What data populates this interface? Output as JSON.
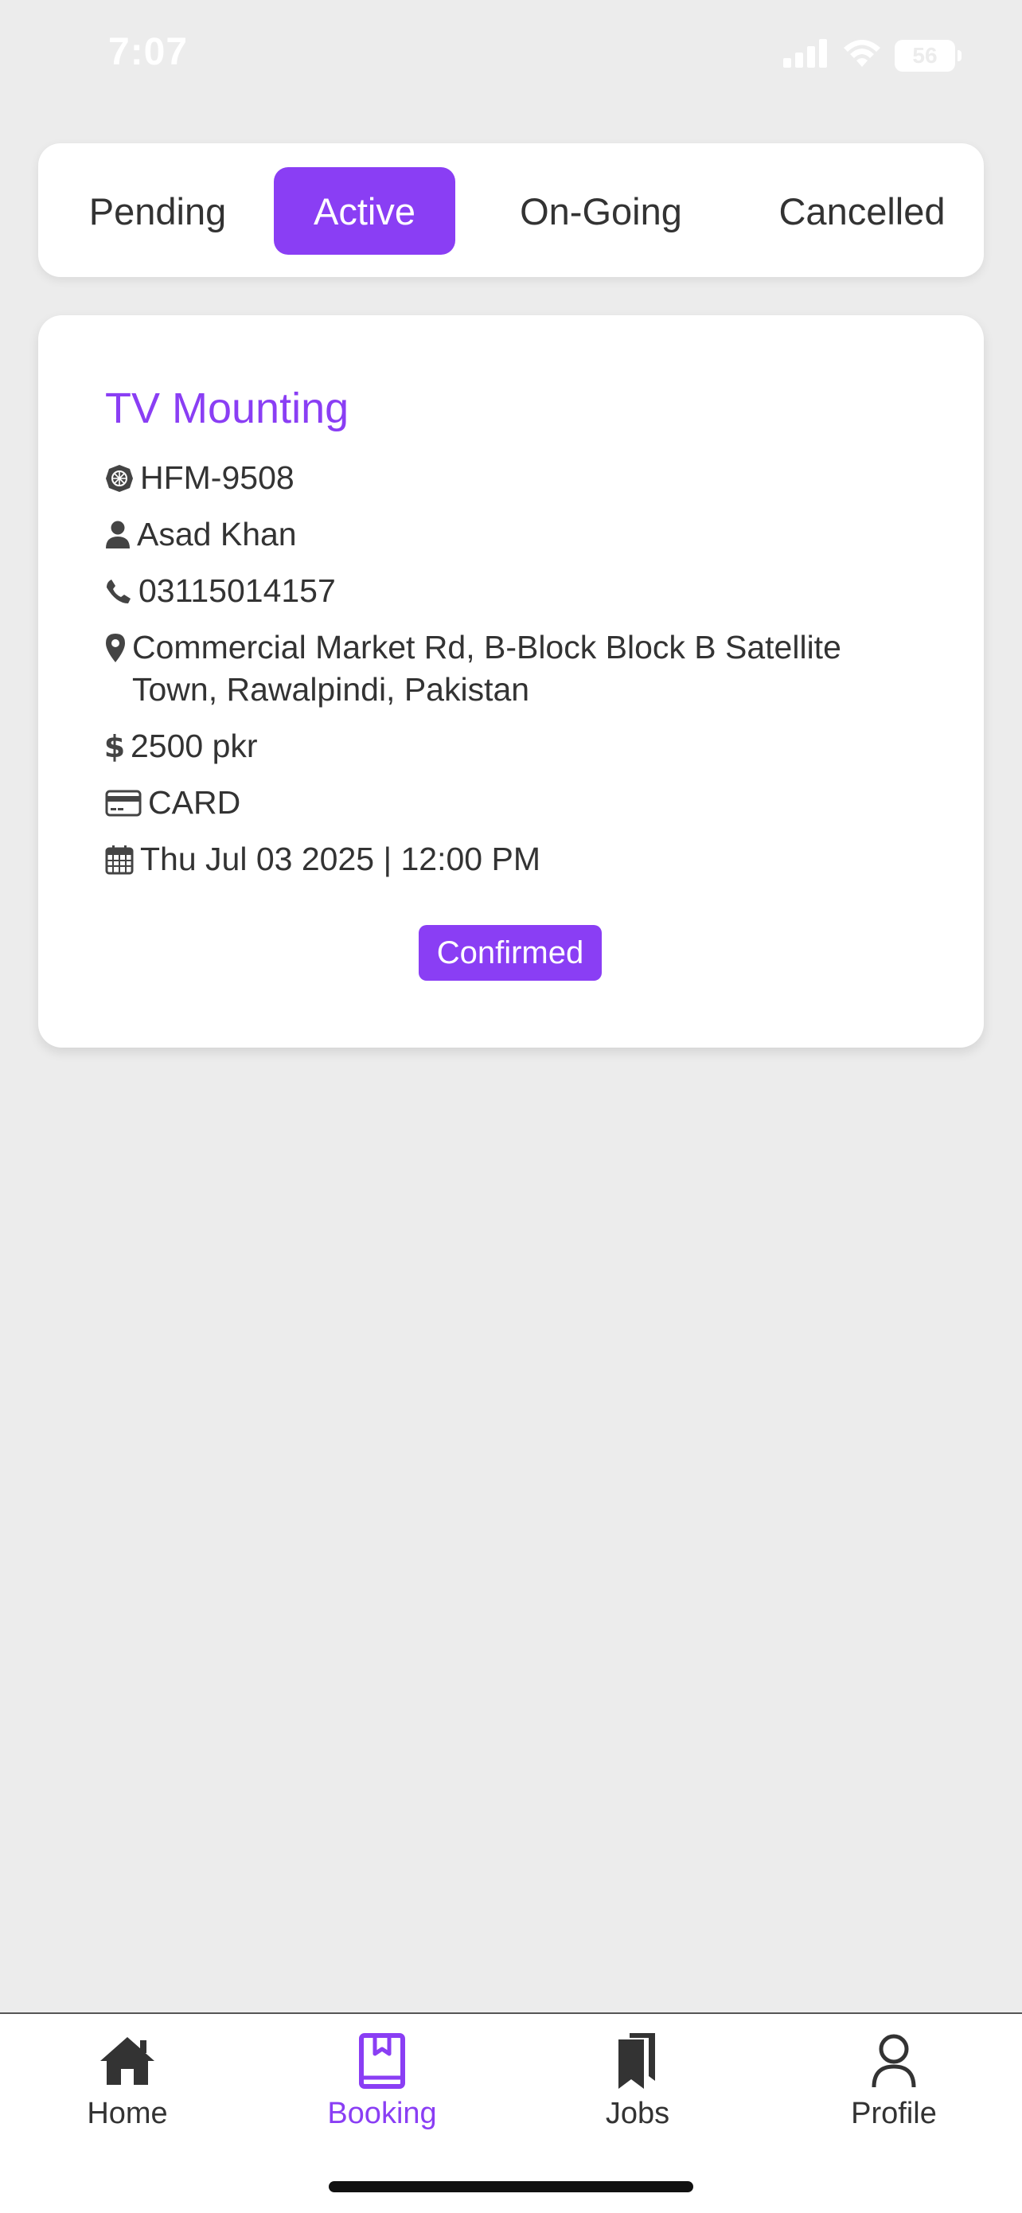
{
  "status_bar": {
    "time": "7:07",
    "battery": "56"
  },
  "tabs": [
    {
      "label": "Pending",
      "active": false
    },
    {
      "label": "Active",
      "active": true
    },
    {
      "label": "On-Going",
      "active": false
    },
    {
      "label": "Cancelled",
      "active": false
    }
  ],
  "booking": {
    "service": "TV Mounting",
    "booking_id": "HFM-9508",
    "customer_name": "Asad Khan",
    "phone": "03115014157",
    "address": "Commercial Market Rd, B-Block Block B Satellite Town, Rawalpindi, Pakistan",
    "price": "2500 pkr",
    "payment_method": "CARD",
    "datetime": "Thu Jul 03 2025 | 12:00 PM",
    "status": "Confirmed"
  },
  "bottom_nav": [
    {
      "label": "Home",
      "icon": "home-icon",
      "active": false
    },
    {
      "label": "Booking",
      "icon": "book-icon",
      "active": true
    },
    {
      "label": "Jobs",
      "icon": "bookmarks-icon",
      "active": false
    },
    {
      "label": "Profile",
      "icon": "user-icon",
      "active": false
    }
  ],
  "colors": {
    "accent": "#8a3ef4",
    "background": "#ececec",
    "text": "#333333"
  }
}
